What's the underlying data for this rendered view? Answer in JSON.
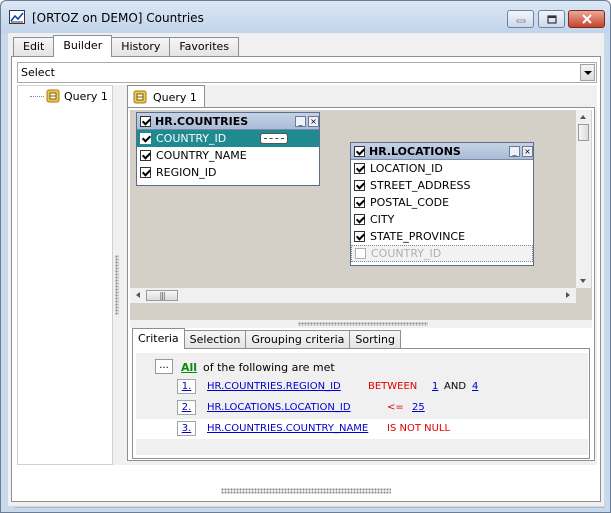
{
  "window": {
    "title": "[ORTOZ on DEMO] Countries"
  },
  "top_tabs": [
    "Edit",
    "Builder",
    "History",
    "Favorites"
  ],
  "statement_type": {
    "value": "Select"
  },
  "tree": {
    "items": [
      {
        "label": "Query 1"
      }
    ]
  },
  "query_tab": {
    "label": "Query 1"
  },
  "tables": [
    {
      "name": "HR.COUNTRIES",
      "fields": [
        {
          "name": "COUNTRY_ID",
          "checked": true,
          "selected": true
        },
        {
          "name": "COUNTRY_NAME",
          "checked": true
        },
        {
          "name": "REGION_ID",
          "checked": true
        }
      ]
    },
    {
      "name": "HR.LOCATIONS",
      "fields": [
        {
          "name": "LOCATION_ID",
          "checked": true
        },
        {
          "name": "STREET_ADDRESS",
          "checked": true
        },
        {
          "name": "POSTAL_CODE",
          "checked": true
        },
        {
          "name": "CITY",
          "checked": true
        },
        {
          "name": "STATE_PROVINCE",
          "checked": true
        },
        {
          "name": "COUNTRY_ID",
          "checked": false,
          "dimmed": true
        }
      ]
    }
  ],
  "criteria_tabs": [
    "Criteria",
    "Selection",
    "Grouping criteria",
    "Sorting"
  ],
  "criteria": {
    "ellipsis": "...",
    "group_operator": "All",
    "group_text": "of the following are met",
    "conditions": [
      {
        "num": "1.",
        "field": "HR.COUNTRIES.REGION_ID",
        "op": "BETWEEN",
        "value1": "1",
        "and": "AND",
        "value2": "4"
      },
      {
        "num": "2.",
        "field": "HR.LOCATIONS.LOCATION_ID",
        "op": "<=",
        "value1": "25"
      },
      {
        "num": "3.",
        "field": "HR.COUNTRIES.COUNTRY_NAME",
        "op": "IS NOT NULL"
      }
    ]
  },
  "colors": {
    "selected_row": "#1f8a8f",
    "criteria_field": "#0000d0",
    "criteria_operator": "#e00000",
    "all_link": "#0a8a0a"
  }
}
